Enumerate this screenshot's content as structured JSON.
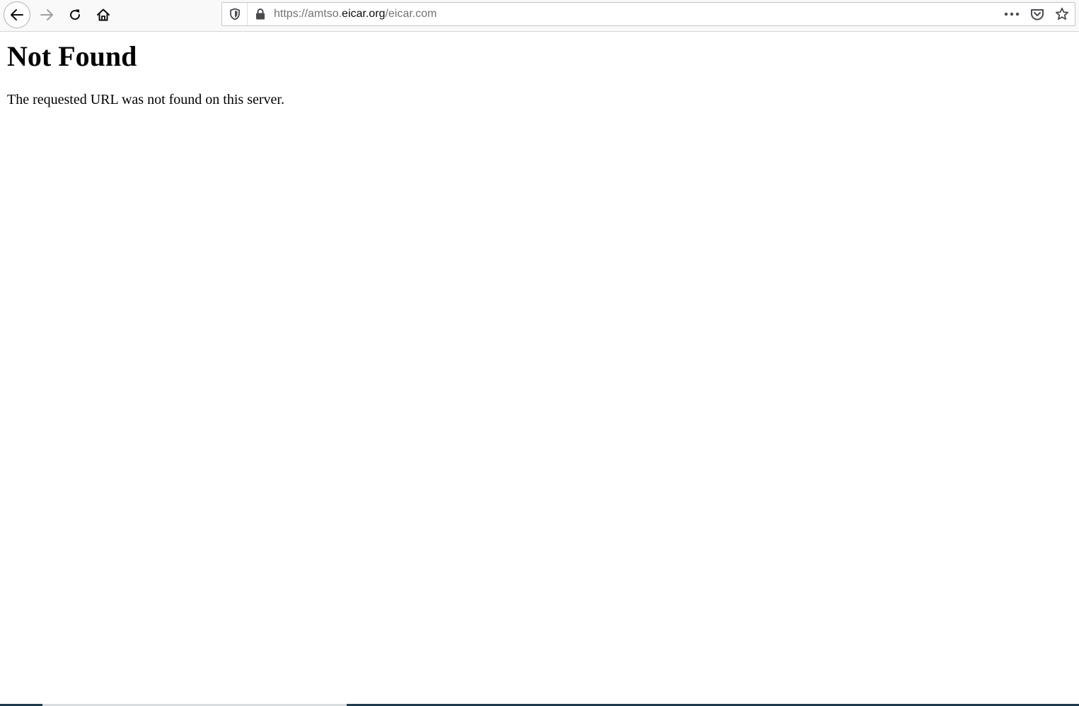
{
  "browser": {
    "url": {
      "prefix": "https://amtso.",
      "domain": "eicar.org",
      "suffix": "/eicar.com"
    },
    "icons": {
      "back": "arrow-left-icon",
      "forward": "arrow-right-icon",
      "reload": "reload-icon",
      "home": "home-icon",
      "tracking": "shield-icon",
      "security": "lock-icon",
      "page_actions": "more-icon",
      "pocket": "pocket-icon",
      "bookmark": "star-icon"
    }
  },
  "page": {
    "heading": "Not Found",
    "message": "The requested URL was not found on this server."
  }
}
